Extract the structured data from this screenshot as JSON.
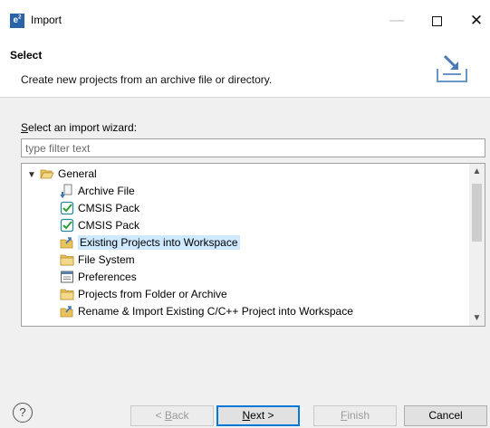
{
  "window": {
    "icon_text": "e",
    "icon_sup": "2",
    "title": "Import",
    "min_glyph": "—",
    "close_glyph": "✕"
  },
  "banner": {
    "title": "Select",
    "description": "Create new projects from an archive file or directory."
  },
  "wizard": {
    "label_accel": "S",
    "label_rest": "elect an import wizard:",
    "filter_placeholder": "type filter text",
    "filter_value": "",
    "tree": [
      {
        "label": "General",
        "icon": "open-folder-icon",
        "expanded": true,
        "level": 0
      },
      {
        "label": "Archive File",
        "icon": "archive-file-icon",
        "level": 1
      },
      {
        "label": "CMSIS Pack",
        "icon": "cmsis-pack-icon",
        "level": 1
      },
      {
        "label": "CMSIS Pack",
        "icon": "cmsis-pack-icon",
        "level": 1
      },
      {
        "label": "Existing Projects into Workspace",
        "icon": "import-project-icon",
        "level": 1,
        "selected": true
      },
      {
        "label": "File System",
        "icon": "folder-icon",
        "level": 1
      },
      {
        "label": "Preferences",
        "icon": "preferences-icon",
        "level": 1
      },
      {
        "label": "Projects from Folder or Archive",
        "icon": "folder-icon",
        "level": 1
      },
      {
        "label": "Rename & Import Existing C/C++ Project into Workspace",
        "icon": "import-project-icon",
        "level": 1
      }
    ]
  },
  "buttons": {
    "help": "?",
    "back_accel": "B",
    "back_prefix": "< ",
    "back_rest": "ack",
    "next_accel": "N",
    "next_rest": "ext >",
    "finish_accel": "F",
    "finish_rest": "inish",
    "cancel": "Cancel"
  },
  "colors": {
    "selection": "#cde8ff",
    "accent": "#0078d7",
    "check_green": "#2e9c3a",
    "folder_yellow": "#e8c25a"
  }
}
